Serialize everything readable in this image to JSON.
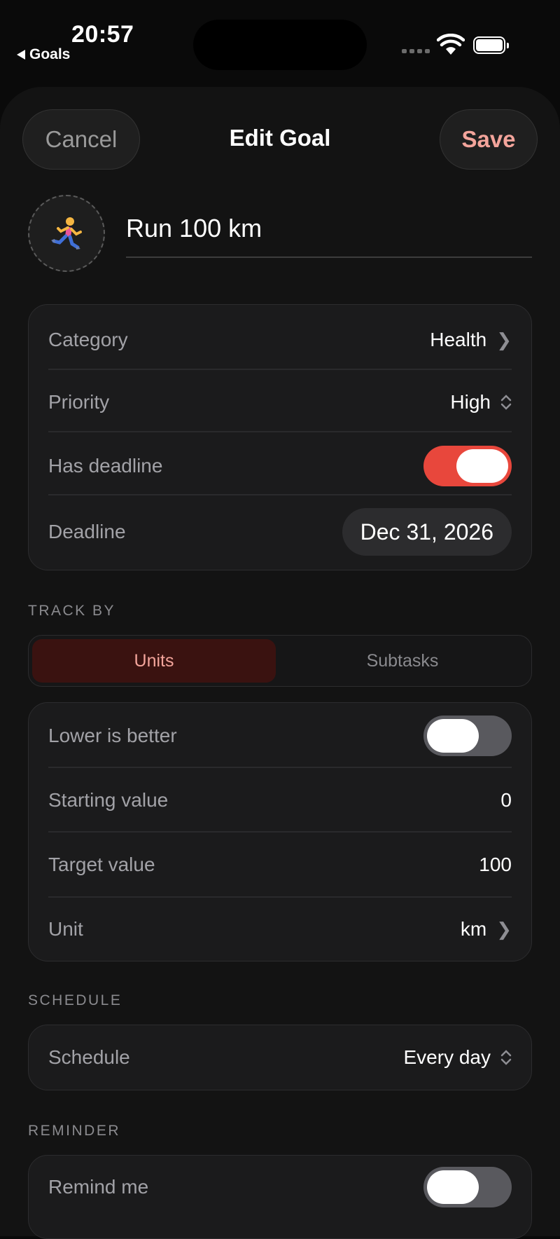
{
  "status_bar": {
    "time": "20:57",
    "back_label": "Goals"
  },
  "nav": {
    "cancel_label": "Cancel",
    "title": "Edit Goal",
    "save_label": "Save"
  },
  "goal": {
    "emoji": "🏃",
    "title": "Run 100 km"
  },
  "details": {
    "category_label": "Category",
    "category_value": "Health",
    "priority_label": "Priority",
    "priority_value": "High",
    "has_deadline_label": "Has deadline",
    "has_deadline_on": true,
    "deadline_label": "Deadline",
    "deadline_value": "Dec 31, 2026"
  },
  "track_by": {
    "header": "TRACK BY",
    "options": [
      "Units",
      "Subtasks"
    ],
    "selected": "Units"
  },
  "units": {
    "lower_is_better_label": "Lower is better",
    "lower_is_better_on": false,
    "starting_value_label": "Starting value",
    "starting_value": "0",
    "target_value_label": "Target value",
    "target_value": "100",
    "unit_label": "Unit",
    "unit_value": "km"
  },
  "schedule": {
    "header": "SCHEDULE",
    "label": "Schedule",
    "value": "Every day"
  },
  "reminder": {
    "header": "REMINDER",
    "label": "Remind me",
    "on": false
  },
  "colors": {
    "accent": "#e8473c",
    "accent_text": "#f3a49b",
    "card_bg": "#1b1b1c",
    "sheet_bg": "#131313"
  }
}
